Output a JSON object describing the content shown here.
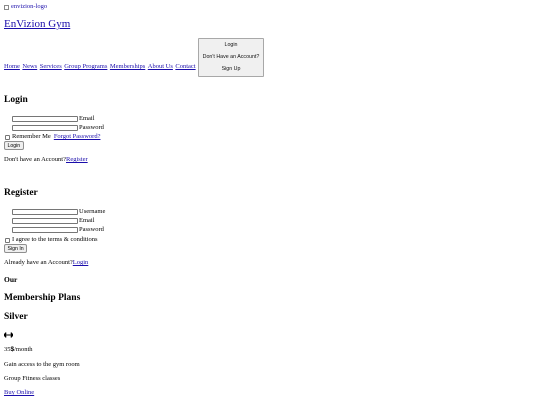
{
  "header": {
    "logo_alt": "envizion-logo",
    "site_title": "EnVizion Gym"
  },
  "nav": {
    "items": [
      "Home",
      "News",
      "Services",
      "Group Programs",
      "Memberships",
      "About Us",
      "Contact"
    ]
  },
  "account_menu": {
    "login": "Login",
    "no_account": "Don't Have an Account?",
    "sign_up": "Sign Up"
  },
  "login_form": {
    "title": "Login",
    "email_label": "Email",
    "password_label": "Password",
    "remember_label": "Remember Me",
    "forgot_link": "Forgot Password?",
    "submit": "Login",
    "prompt": "Don't have an Account?",
    "register_link": "Register"
  },
  "register_form": {
    "title": "Register",
    "username_label": "Username",
    "email_label": "Email",
    "password_label": "Password",
    "terms_label": "I agree to the terms & conditions",
    "submit": "Sign In",
    "prompt": "Already have an Account?",
    "login_link": "Login"
  },
  "memberships": {
    "prefix": "Our",
    "title": "Membership Plans",
    "plan": {
      "name": "Silver",
      "icon": "dumbbell-icon",
      "price": "35",
      "currency": "$",
      "period": "/month",
      "feature_1": "Gain access to the gym room",
      "feature_2": "Group Fitness classes",
      "cta": "Buy Online"
    }
  }
}
